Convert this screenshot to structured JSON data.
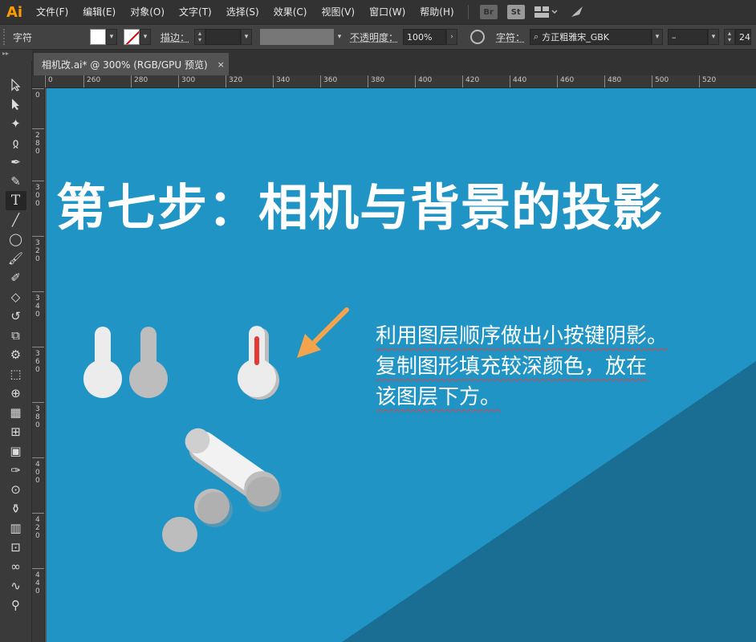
{
  "menubar": {
    "logo": "Ai",
    "items": [
      "文件(F)",
      "编辑(E)",
      "对象(O)",
      "文字(T)",
      "选择(S)",
      "效果(C)",
      "视图(V)",
      "窗口(W)",
      "帮助(H)"
    ],
    "icons": [
      "bridge-icon",
      "stock-icon",
      "workspace-layout-icon",
      "rocket-icon"
    ],
    "br_label": "Br",
    "st_label": "St"
  },
  "controlbar": {
    "panel_label": "字符",
    "stroke_label": "描边：",
    "opacity_label": "不透明度：",
    "opacity_value": "100%",
    "font_label": "字符：",
    "font_value": "方正粗雅宋_GBK",
    "font_style_value": "–",
    "font_size_value": "24"
  },
  "document": {
    "tab_title": "相机改.ai* @ 300% (RGB/GPU 预览)",
    "close": "×"
  },
  "rulers": {
    "horizontal": [
      "0",
      "260",
      "280",
      "300",
      "320",
      "340",
      "360",
      "380",
      "400",
      "420",
      "440",
      "460",
      "480",
      "500",
      "520"
    ],
    "vertical": [
      "0",
      "2\n8\n0",
      "3\n0\n0",
      "3\n2\n0",
      "3\n4\n0",
      "3\n6\n0",
      "3\n8\n0",
      "4\n0\n0",
      "4\n2\n0",
      "4\n4\n0"
    ]
  },
  "artboard": {
    "title": "第七步：相机与背景的投影",
    "note_lines": [
      "利用图层顺序做出小按键阴影。",
      "复制图形填充较深颜色，放在",
      "该图层下方。"
    ],
    "colors": {
      "background": "#2094c4",
      "shadow_triangle": "#1a6e94",
      "key_light": "#ececec",
      "key_shadow": "#bdbdbd",
      "indicator_red": "#e53935",
      "arrow_orange": "#f5a44e"
    }
  }
}
